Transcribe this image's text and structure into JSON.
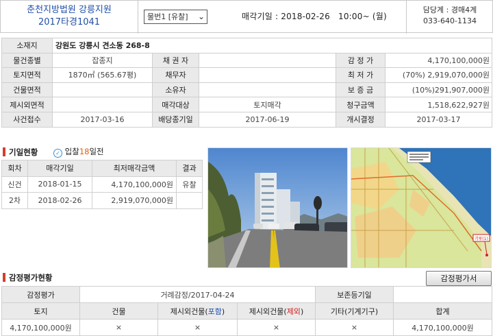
{
  "header": {
    "court_line1": "춘천지방법원 강릉지원",
    "court_line2": "2017타경1041",
    "item_select": "물번1 [유찰]",
    "sale_date": "매각기일 : 2018-02-26   10:00~ (월)",
    "manager_line1": "담당계 : 경매4계",
    "manager_line2": "033-640-1134"
  },
  "info": {
    "location_label": "소재지",
    "location_value": "강원도 강릉시 견소동 268-8",
    "type_label": "물건종별",
    "type_value": "잡종지",
    "creditor_label": "채 권 자",
    "creditor_value": "",
    "appraisal_label": "감 정 가",
    "appraisal_value": "4,170,100,000원",
    "land_label": "토지면적",
    "land_value": "1870㎡ (565.67평)",
    "debtor_label": "채무자",
    "debtor_value": "",
    "min_label": "최 저 가",
    "min_value": "(70%) 2,919,070,000원",
    "building_label": "건물면적",
    "building_value": "",
    "owner_label": "소유자",
    "owner_value": "",
    "deposit_label": "보 증 금",
    "deposit_value": "(10%)291,907,000원",
    "excluded_label": "제시외면적",
    "excluded_value": "",
    "target_label": "매각대상",
    "target_value": "토지매각",
    "claim_label": "청구금액",
    "claim_value": "1,518,622,927원",
    "receipt_label": "사건접수",
    "receipt_value": "2017-03-16",
    "dividend_label": "배당종기일",
    "dividend_value": "2017-06-19",
    "start_label": "개시결정",
    "start_value": "2017-03-17"
  },
  "bid": {
    "title": "기일현황",
    "badge_text": "입찰",
    "badge_days": "18",
    "badge_suffix": "일전",
    "headers": [
      "회차",
      "매각기일",
      "최저매각금액",
      "결과"
    ],
    "rows": [
      {
        "round": "신건",
        "date": "2018-01-15",
        "amount": "4,170,100,000원",
        "result": "유찰"
      },
      {
        "round": "2차",
        "date": "2018-02-26",
        "amount": "2,919,070,000원",
        "result": ""
      }
    ]
  },
  "map": {
    "legend_text": "",
    "pin_text": "기루(1)"
  },
  "appraisal": {
    "title": "감정평가현황",
    "button_label": "감정평가서",
    "eval_label": "감정평가",
    "eval_value": "거례감정/2017-04-24",
    "preserve_label": "보존등기일",
    "preserve_value": "",
    "headers": {
      "land": "토지",
      "building": "건물",
      "excl_in_prefix": "제시외건물(",
      "excl_in_word": "포함",
      "excl_out_prefix": "제시외건물(",
      "excl_out_word": "제외",
      "close": ")",
      "etc": "기타(기계기구)",
      "total": "합계"
    },
    "values": {
      "land": "4,170,100,000원",
      "building": "×",
      "excl_in": "×",
      "excl_out": "×",
      "etc": "×",
      "total": "4,170,100,000원"
    }
  },
  "colors": {
    "court_blue": "#1f4fa8",
    "accent_red": "#b0261c",
    "label_bg": "#eaeaea"
  }
}
